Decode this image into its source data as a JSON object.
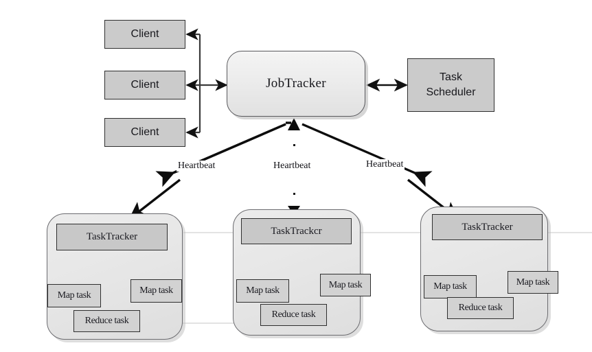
{
  "diagram": {
    "title": "Hadoop MapReduce JobTracker / TaskTracker architecture",
    "colors": {
      "node_gray": "#cbcbcb",
      "cluster_gray": "#e4e4e4",
      "header_gray": "#c8c8c8",
      "task_gray": "#d2d2d2",
      "stroke": "#2e2e2e",
      "arrow_black": "#111111",
      "arrow_dark_gray": "#4a4a4a",
      "background": "#ffffff"
    }
  },
  "clients": [
    {
      "label": "Client"
    },
    {
      "label": "Client"
    },
    {
      "label": "Client"
    }
  ],
  "jobtracker": {
    "label": "JobTracker"
  },
  "scheduler": {
    "line1": "Task",
    "line2": "Scheduler"
  },
  "heartbeats": [
    {
      "label": "Heartbeat"
    },
    {
      "label": "Heartbeat"
    },
    {
      "label": "Heartbeat"
    }
  ],
  "clusters": [
    {
      "tracker": "TaskTracker",
      "map_left": "Map task",
      "map_right": "Map task",
      "reduce": "Reduce task"
    },
    {
      "tracker": "TaskTrackcr",
      "map_left": "Map task",
      "map_right": "Map task",
      "reduce": "Reduce task"
    },
    {
      "tracker": "TaskTracker",
      "map_left": "Map task",
      "map_right": "Map task",
      "reduce": "Reduce task"
    }
  ]
}
